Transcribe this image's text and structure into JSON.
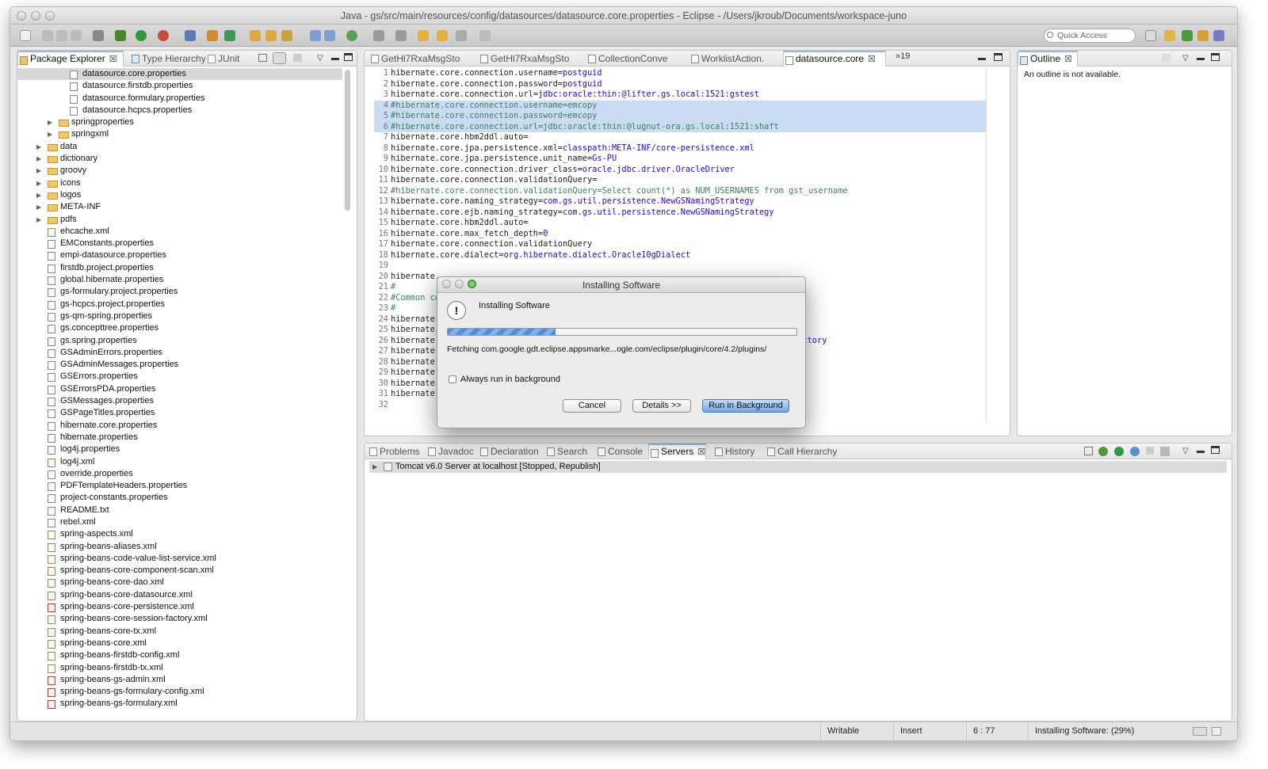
{
  "window": {
    "title": "Java - gs/src/main/resources/config/datasources/datasource.core.properties - Eclipse - /Users/jkroub/Documents/workspace-juno"
  },
  "toolbar": {
    "quick_access_placeholder": "Quick Access"
  },
  "explorer": {
    "tabs": [
      "Package Explorer",
      "Type Hierarchy",
      "JUnit"
    ],
    "items": [
      {
        "label": "datasource.core.properties",
        "level": 3,
        "kind": "file",
        "selected": true
      },
      {
        "label": "datasource.firstdb.properties",
        "level": 3,
        "kind": "file"
      },
      {
        "label": "datasource.formulary.properties",
        "level": 3,
        "kind": "file"
      },
      {
        "label": "datasource.hcpcs.properties",
        "level": 3,
        "kind": "file"
      },
      {
        "label": "springproperties",
        "level": 2,
        "kind": "folder"
      },
      {
        "label": "springxml",
        "level": 2,
        "kind": "folder"
      },
      {
        "label": "data",
        "level": 1,
        "kind": "folder"
      },
      {
        "label": "dictionary",
        "level": 1,
        "kind": "folder"
      },
      {
        "label": "groovy",
        "level": 1,
        "kind": "folder"
      },
      {
        "label": "icons",
        "level": 1,
        "kind": "folder"
      },
      {
        "label": "logos",
        "level": 1,
        "kind": "folder"
      },
      {
        "label": "META-INF",
        "level": 1,
        "kind": "folder"
      },
      {
        "label": "pdfs",
        "level": 1,
        "kind": "folder"
      },
      {
        "label": "ehcache.xml",
        "level": 1,
        "kind": "xml"
      },
      {
        "label": "EMConstants.properties",
        "level": 1,
        "kind": "file"
      },
      {
        "label": "empi-datasource.properties",
        "level": 1,
        "kind": "file"
      },
      {
        "label": "firstdb.project.properties",
        "level": 1,
        "kind": "file"
      },
      {
        "label": "global.hibernate.properties",
        "level": 1,
        "kind": "file"
      },
      {
        "label": "gs-formulary.project.properties",
        "level": 1,
        "kind": "file"
      },
      {
        "label": "gs-hcpcs.project.properties",
        "level": 1,
        "kind": "file"
      },
      {
        "label": "gs-qm-spring.properties",
        "level": 1,
        "kind": "file"
      },
      {
        "label": "gs.concepttree.properties",
        "level": 1,
        "kind": "file"
      },
      {
        "label": "gs.spring.properties",
        "level": 1,
        "kind": "file"
      },
      {
        "label": "GSAdminErrors.properties",
        "level": 1,
        "kind": "file"
      },
      {
        "label": "GSAdminMessages.properties",
        "level": 1,
        "kind": "file"
      },
      {
        "label": "GSErrors.properties",
        "level": 1,
        "kind": "file"
      },
      {
        "label": "GSErrorsPDA.properties",
        "level": 1,
        "kind": "file"
      },
      {
        "label": "GSMessages.properties",
        "level": 1,
        "kind": "file"
      },
      {
        "label": "GSPageTitles.properties",
        "level": 1,
        "kind": "file"
      },
      {
        "label": "hibernate.core.properties",
        "level": 1,
        "kind": "file"
      },
      {
        "label": "hibernate.properties",
        "level": 1,
        "kind": "file"
      },
      {
        "label": "log4j.properties",
        "level": 1,
        "kind": "file"
      },
      {
        "label": "log4j.xml",
        "level": 1,
        "kind": "xml"
      },
      {
        "label": "override.properties",
        "level": 1,
        "kind": "file"
      },
      {
        "label": "PDFTemplateHeaders.properties",
        "level": 1,
        "kind": "file"
      },
      {
        "label": "project-constants.properties",
        "level": 1,
        "kind": "file"
      },
      {
        "label": "README.txt",
        "level": 1,
        "kind": "file"
      },
      {
        "label": "rebel.xml",
        "level": 1,
        "kind": "file"
      },
      {
        "label": "spring-aspects.xml",
        "level": 1,
        "kind": "xml"
      },
      {
        "label": "spring-beans-aliases.xml",
        "level": 1,
        "kind": "xml"
      },
      {
        "label": "spring-beans-code-value-list-service.xml",
        "level": 1,
        "kind": "xml"
      },
      {
        "label": "spring-beans-core-component-scan.xml",
        "level": 1,
        "kind": "xml"
      },
      {
        "label": "spring-beans-core-dao.xml",
        "level": 1,
        "kind": "xml"
      },
      {
        "label": "spring-beans-core-datasource.xml",
        "level": 1,
        "kind": "xml"
      },
      {
        "label": "spring-beans-core-persistence.xml",
        "level": 1,
        "kind": "err"
      },
      {
        "label": "spring-beans-core-session-factory.xml",
        "level": 1,
        "kind": "xml"
      },
      {
        "label": "spring-beans-core-tx.xml",
        "level": 1,
        "kind": "xml"
      },
      {
        "label": "spring-beans-core.xml",
        "level": 1,
        "kind": "xml"
      },
      {
        "label": "spring-beans-firstdb-config.xml",
        "level": 1,
        "kind": "xml"
      },
      {
        "label": "spring-beans-firstdb-tx.xml",
        "level": 1,
        "kind": "xml"
      },
      {
        "label": "spring-beans-gs-admin.xml",
        "level": 1,
        "kind": "err"
      },
      {
        "label": "spring-beans-gs-formulary-config.xml",
        "level": 1,
        "kind": "err"
      },
      {
        "label": "spring-beans-gs-formulary.xml",
        "level": 1,
        "kind": "err"
      }
    ]
  },
  "editor": {
    "tabs": [
      "GetHl7RxaMsgSto",
      "GetHl7RxaMsgSto",
      "CollectionConve",
      "WorklistAction.",
      "datasource.core"
    ],
    "overflow": "»19",
    "lines": [
      {
        "k": "hibernate.core.connection.username=",
        "v": "postguid"
      },
      {
        "k": "hibernate.core.connection.password=",
        "v": "postguid"
      },
      {
        "k": "hibernate.core.connection.url=",
        "v": "jdbc:oracle:thin:@lifter.gs.local:1521:gstest"
      },
      {
        "c": "#hibernate.core.connection.username=emcopy",
        "hl": true
      },
      {
        "c": "#hibernate.core.connection.password=emcopy",
        "hl": true
      },
      {
        "c": "#hibernate.core.connection.url=jdbc:oracle:thin:@lugnut-ora.gs.local:1521:shaft",
        "hl": true
      },
      {
        "k": "hibernate.core.hbm2ddl.auto="
      },
      {
        "k": "hibernate.core.jpa.persistence.xml=",
        "v": "classpath:META-INF/core-persistence.xml"
      },
      {
        "k": "hibernate.core.jpa.persistence.unit_name=",
        "v": "Gs-PU"
      },
      {
        "k": "hibernate.core.connection.driver_class=",
        "v": "oracle.jdbc.driver.OracleDriver"
      },
      {
        "k": "hibernate.core.connection.validationQuery="
      },
      {
        "c": "#hibernate.core.connection.validationQuery=Select count(*) as NUM_USERNAMES from gst_username"
      },
      {
        "k": "hibernate.core.naming_strategy=",
        "v": "com.gs.util.persistence.NewGSNamingStrategy"
      },
      {
        "k": "hibernate.core.ejb.naming_strategy=",
        "v": "com.gs.util.persistence.NewGSNamingStrategy"
      },
      {
        "k": "hibernate.core.hbm2ddl.auto="
      },
      {
        "k": "hibernate.core.max_fetch_depth=",
        "v": "0"
      },
      {
        "k": "hibernate.core.connection.validationQuery"
      },
      {
        "k": "hibernate.core.dialect=",
        "v": "org.hibernate.dialect.Oracle10gDialect"
      },
      {
        "k": ""
      },
      {
        "k": "hibernate."
      },
      {
        "c": "#"
      },
      {
        "c": "#Common co"
      },
      {
        "c": "#"
      },
      {
        "k": "hibernate."
      },
      {
        "k": "hibernate."
      },
      {
        "k": "hibernate.",
        "tail": "Factory"
      },
      {
        "k": "hibernate."
      },
      {
        "k": "hibernate."
      },
      {
        "k": "hibernate."
      },
      {
        "k": "hibernate."
      },
      {
        "k": "hibernate."
      },
      {
        "k": ""
      }
    ]
  },
  "outline": {
    "tab": "Outline",
    "message": "An outline is not available."
  },
  "bottom": {
    "tabs": [
      "Problems",
      "Javadoc",
      "Declaration",
      "Search",
      "Console",
      "Servers",
      "History",
      "Call Hierarchy"
    ],
    "active": "Servers",
    "server_row": "Tomcat v6.0 Server at localhost  [Stopped, Republish]"
  },
  "dialog": {
    "title": "Installing Software",
    "heading": "Installing Software",
    "progress": 0.31,
    "message": "Fetching com.google.gdt.eclipse.appsmarke...ogle.com/eclipse/plugin/core/4.2/plugins/",
    "checkbox_label": "Always run in background",
    "cancel": "Cancel",
    "details": "Details >>",
    "run_bg": "Run in Background"
  },
  "status": {
    "writable": "Writable",
    "insert": "Insert",
    "position": "6 : 77",
    "progress_text": "Installing Software: (29%)"
  },
  "colors": {
    "keyword": "#222222",
    "value": "#2a00ff",
    "comment": "#3f7f5f",
    "highlight": "#c9dcf4"
  }
}
